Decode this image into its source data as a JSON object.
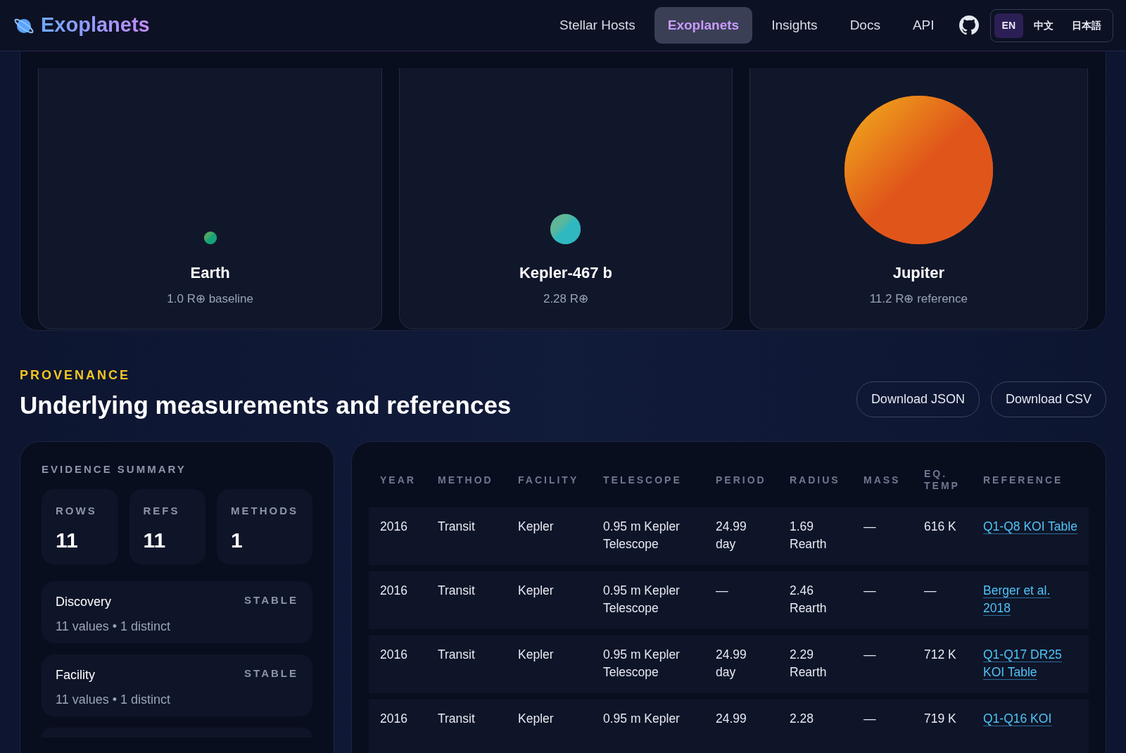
{
  "brand": {
    "title": "Exoplanets"
  },
  "nav": [
    {
      "label": "Stellar Hosts",
      "selected": false
    },
    {
      "label": "Exoplanets",
      "selected": true
    },
    {
      "label": "Insights",
      "selected": false
    },
    {
      "label": "Docs",
      "selected": false
    },
    {
      "label": "API",
      "selected": false
    }
  ],
  "languages": [
    {
      "label": "EN",
      "selected": true
    },
    {
      "label": "中文",
      "selected": false
    },
    {
      "label": "日本語",
      "selected": false
    }
  ],
  "comparison": [
    {
      "name": "Earth",
      "caption": "1.0 R⊕ baseline",
      "color": "#16a37a"
    },
    {
      "name": "Kepler-467 b",
      "caption": "2.28 R⊕",
      "color": "#2fb8c0"
    },
    {
      "name": "Jupiter",
      "caption": "11.2 R⊕ reference",
      "color": "#e0561a"
    }
  ],
  "provenance": {
    "eyebrow": "PROVENANCE",
    "heading": "Underlying measurements and references",
    "buttons": [
      "Download JSON",
      "Download CSV"
    ]
  },
  "evidence": {
    "title": "EVIDENCE SUMMARY",
    "stats": [
      {
        "label": "ROWS",
        "value": "11"
      },
      {
        "label": "REFS",
        "value": "11"
      },
      {
        "label": "METHODS",
        "value": "1"
      }
    ],
    "fields": [
      {
        "name": "Discovery",
        "status": "STABLE",
        "detail": "11 values • 1 distinct"
      },
      {
        "name": "Facility",
        "status": "STABLE",
        "detail": "11 values • 1 distinct"
      }
    ]
  },
  "table": {
    "columns": [
      "YEAR",
      "METHOD",
      "FACILITY",
      "TELESCOPE",
      "PERIOD",
      "RADIUS",
      "MASS",
      "EQ. TEMP",
      "REFERENCE"
    ],
    "rows": [
      [
        "2016",
        "Transit",
        "Kepler",
        "0.95 m Kepler Telescope",
        "24.99 day",
        "1.69 Rearth",
        "—",
        "616 K",
        "Q1-Q8 KOI Table"
      ],
      [
        "2016",
        "Transit",
        "Kepler",
        "0.95 m Kepler Telescope",
        "—",
        "2.46 Rearth",
        "—",
        "—",
        "Berger et al. 2018"
      ],
      [
        "2016",
        "Transit",
        "Kepler",
        "0.95 m Kepler Telescope",
        "24.99 day",
        "2.29 Rearth",
        "—",
        "712 K",
        "Q1-Q17 DR25 KOI Table"
      ],
      [
        "2016",
        "Transit",
        "Kepler",
        "0.95 m Kepler",
        "24.99",
        "2.28",
        "—",
        "719 K",
        "Q1-Q16 KOI"
      ]
    ]
  }
}
